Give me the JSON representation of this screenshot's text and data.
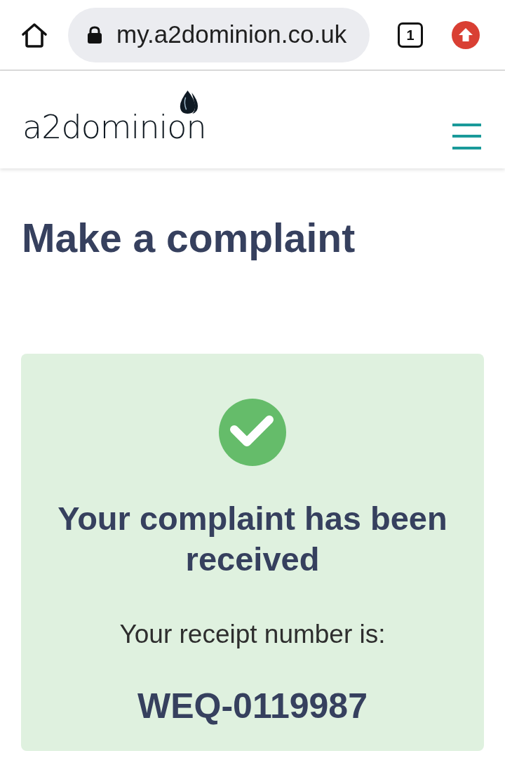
{
  "browser": {
    "url": "my.a2dominion.co.uk",
    "tab_count": "1"
  },
  "header": {
    "logo": "a2dominion"
  },
  "page": {
    "title": "Make a complaint"
  },
  "confirmation": {
    "heading": "Your complaint has been received",
    "receipt_label": "Your receipt number is:",
    "receipt_number": "WEQ-0119987"
  }
}
